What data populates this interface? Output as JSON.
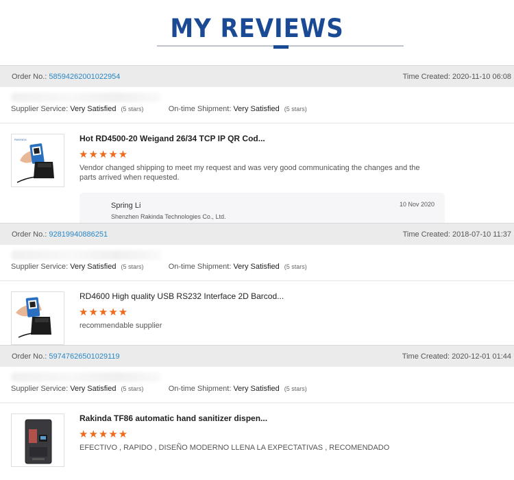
{
  "header": {
    "title": "MY REVIEWS"
  },
  "orders": [
    {
      "order_label": "Order No.:",
      "order_no": "58594262001022954",
      "created_label": "Time Created:",
      "created": "2020-11-10 06:08",
      "supplier_label": "Supplier Service:",
      "supplier_value": "Very Satisfied",
      "supplier_stars": "(5 stars)",
      "shipment_label": "On-time Shipment:",
      "shipment_value": "Very Satisfied",
      "shipment_stars": "(5 stars)",
      "product": "Hot RD4500-20 Weigand 26/34 TCP IP QR Cod...",
      "stars": "★★★★★",
      "comment": "Vendor changed shipping to meet my request and was very good communicating the changes and the parts arrived when requested.",
      "reply": {
        "name": "Spring Li",
        "company": "Shenzhen Rakinda Technologies Co., Ltd.",
        "date": "10 Nov 2020"
      }
    },
    {
      "order_label": "Order No.:",
      "order_no": "92819940886251",
      "created_label": "Time Created:",
      "created": "2018-07-10 11:37",
      "supplier_label": "Supplier Service:",
      "supplier_value": "Very Satisfied",
      "supplier_stars": "(5 stars)",
      "shipment_label": "On-time Shipment:",
      "shipment_value": "Very Satisfied",
      "shipment_stars": "(5 stars)",
      "product": "RD4600 High quality USB RS232 Interface 2D Barcod...",
      "stars": "★★★★★",
      "comment": "recommendable supplier"
    },
    {
      "order_label": "Order No.:",
      "order_no": "59747626501029119",
      "created_label": "Time Created:",
      "created": "2020-12-01 01:44",
      "supplier_label": "Supplier Service:",
      "supplier_value": "Very Satisfied",
      "supplier_stars": "(5 stars)",
      "shipment_label": "On-time Shipment:",
      "shipment_value": "Very Satisfied",
      "shipment_stars": "(5 stars)",
      "product": "Rakinda TF86 automatic hand sanitizer dispen...",
      "stars": "★★★★★",
      "comment": "EFECTIVO , RAPIDO , DISEÑO MODERNO LLENA LA EXPECTATIVAS , RECOMENDADO"
    }
  ],
  "colors": {
    "brand": "#1a4a93",
    "star": "#ee6a1c",
    "link": "#2a86c6"
  }
}
